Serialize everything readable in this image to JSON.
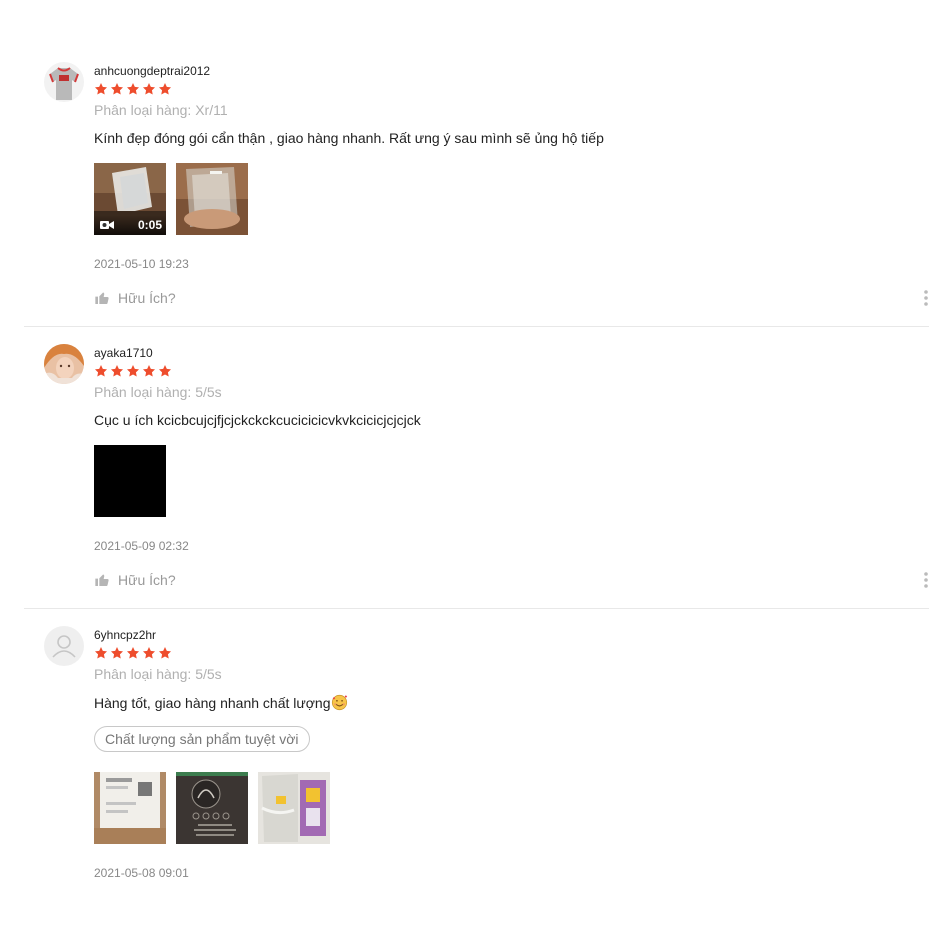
{
  "colors": {
    "star": "#ee4d2d",
    "muted": "#b0b0b0"
  },
  "icons": {
    "rating": "star-icon",
    "helpful": "thumbs-up-icon",
    "more": "more-vertical-icon",
    "video": "video-camera-icon",
    "avatar_default": "user-icon",
    "emoji": "smiling-face-with-hearts-icon"
  },
  "reviews": [
    {
      "username": "anhcuongdeptrai2012",
      "rating": 5,
      "variation": "Phân loại hàng: Xr/11",
      "comment": "Kính đẹp đóng gói cẩn thận , giao hàng nhanh. Rất ưng ý sau mình sẽ ủng hộ tiếp",
      "video_duration": "0:05",
      "date": "2021-05-10 19:23",
      "helpful_label": "Hữu Ích?"
    },
    {
      "username": "ayaka1710",
      "rating": 5,
      "variation": "Phân loại hàng: 5/5s",
      "comment": "Cục u ích kcicbcujcjfjcjckckckcucicicicvkvkcicicjcjcjck",
      "date": "2021-05-09 02:32",
      "helpful_label": "Hữu Ích?"
    },
    {
      "username": "6yhncpz2hr",
      "rating": 5,
      "variation": "Phân loại hàng: 5/5s",
      "comment": "Hàng tốt, giao hàng nhanh chất lượng",
      "tag": "Chất lượng sản phẩm tuyệt vời",
      "date": "2021-05-08 09:01"
    }
  ]
}
